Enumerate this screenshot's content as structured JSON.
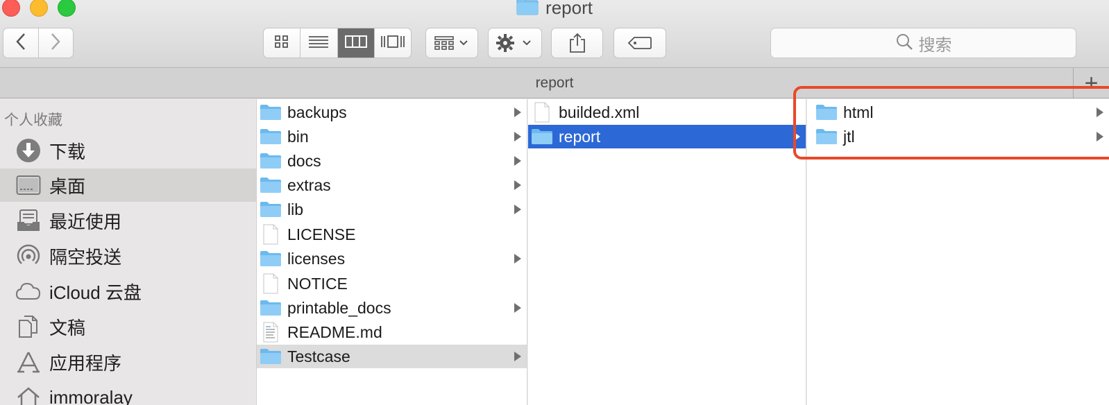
{
  "window": {
    "title": "report"
  },
  "toolbar": {
    "search_placeholder": "搜索",
    "icons": [
      "chevron-left-icon",
      "chevron-right-icon",
      "icon-view-icon",
      "list-view-icon",
      "column-view-icon",
      "gallery-view-icon",
      "group-icon",
      "gear-icon",
      "share-icon",
      "tag-icon",
      "search-icon"
    ]
  },
  "tabbar": {
    "label": "report",
    "add_label": "+"
  },
  "sidebar": {
    "section": "个人收藏",
    "items": [
      {
        "label": "下载",
        "icon": "download-icon"
      },
      {
        "label": "桌面",
        "icon": "desktop-icon",
        "selected": true
      },
      {
        "label": "最近使用",
        "icon": "recents-icon"
      },
      {
        "label": "隔空投送",
        "icon": "airdrop-icon"
      },
      {
        "label": "iCloud 云盘",
        "icon": "cloud-icon"
      },
      {
        "label": "文稿",
        "icon": "documents-icon"
      },
      {
        "label": "应用程序",
        "icon": "applications-icon"
      },
      {
        "label": "immoralay",
        "icon": "home-icon"
      }
    ]
  },
  "columns": [
    {
      "items": [
        {
          "name": "backups",
          "type": "folder"
        },
        {
          "name": "bin",
          "type": "folder"
        },
        {
          "name": "docs",
          "type": "folder"
        },
        {
          "name": "extras",
          "type": "folder"
        },
        {
          "name": "lib",
          "type": "folder"
        },
        {
          "name": "LICENSE",
          "type": "file"
        },
        {
          "name": "licenses",
          "type": "folder"
        },
        {
          "name": "NOTICE",
          "type": "file"
        },
        {
          "name": "printable_docs",
          "type": "folder"
        },
        {
          "name": "README.md",
          "type": "text-file"
        },
        {
          "name": "Testcase",
          "type": "folder",
          "selected": "inactive"
        }
      ]
    },
    {
      "items": [
        {
          "name": "builded.xml",
          "type": "file"
        },
        {
          "name": "report",
          "type": "folder",
          "selected": "active"
        }
      ]
    },
    {
      "items": [
        {
          "name": "html",
          "type": "folder"
        },
        {
          "name": "jtl",
          "type": "folder"
        }
      ]
    }
  ],
  "colors": {
    "selection_blue": "#2c68d6",
    "annotation_red": "#e8492a",
    "folder_blue": "#6cb9ee"
  }
}
